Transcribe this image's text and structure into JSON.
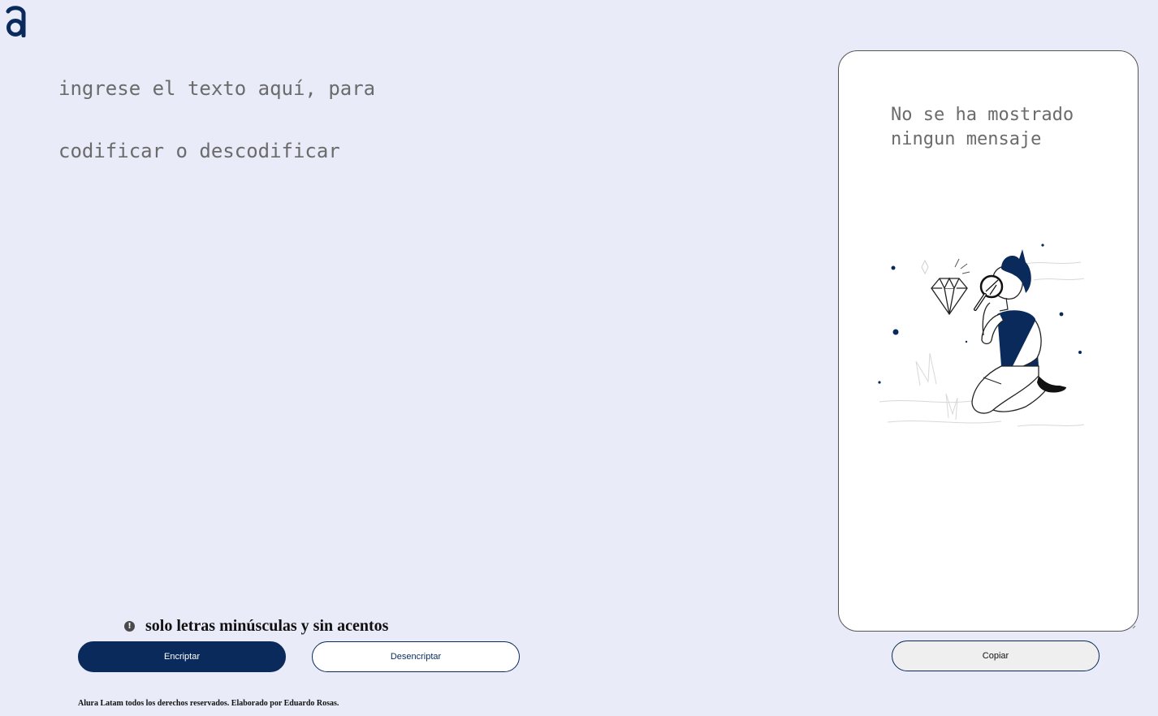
{
  "input": {
    "placeholder": "ingrese el texto aquí, para\ncodificar o descodificar"
  },
  "warning": {
    "icon": "exclamation-circle-icon",
    "text": "solo letras minúsculas y sin acentos"
  },
  "buttons": {
    "encrypt_label": "Encriptar",
    "decrypt_label": "Desencriptar",
    "copy_label": "Copiar"
  },
  "output": {
    "message": "No se ha mostrado ningun mensaje",
    "illustration": "person-with-magnifier-illustration"
  },
  "footer": {
    "text": "Alura Latam todos los derechos reservados. Elaborado por Eduardo Rosas."
  },
  "colors": {
    "primary": "#0a2a5c",
    "background": "#e9ebf8",
    "text_gray": "#6b6b6b"
  }
}
